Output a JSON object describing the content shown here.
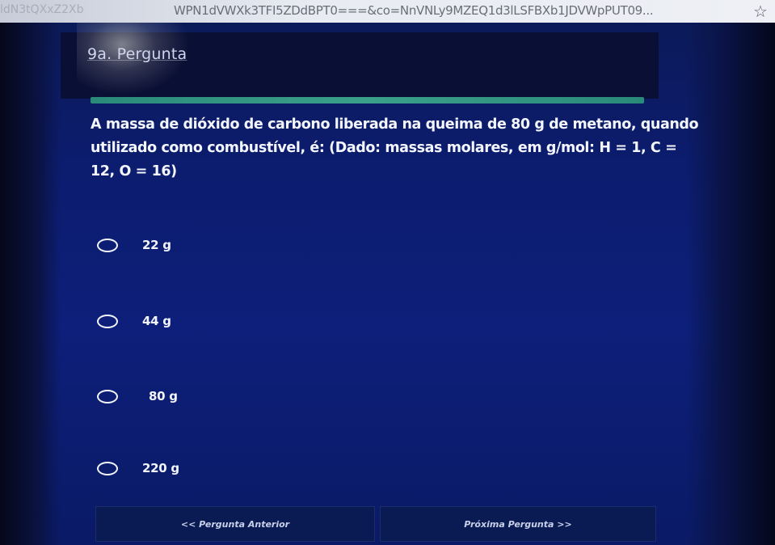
{
  "browser": {
    "url_visible": "WPN1dVWXk3TFI5ZDdBPT0===&co=NnVNLy9MZEQ1d3lLSFBXb1JDVWpPUT09...",
    "url_left_fragment": "ldN3tQXxZ2Xb"
  },
  "page": {
    "title": "9a. Pergunta"
  },
  "question": {
    "text": "A massa de dióxido de carbono liberada na queima de 80 g de metano, quando utilizado como combustível, é: (Dado: massas molares, em g/mol: H = 1, C = 12, O = 16)"
  },
  "options": [
    {
      "label": "22 g"
    },
    {
      "label": "44 g"
    },
    {
      "label": "80 g"
    },
    {
      "label": "220 g"
    }
  ],
  "nav": {
    "prev_label": "<< Pergunta Anterior",
    "next_label": "Próxima Pergunta >>"
  },
  "colors": {
    "background": "#0d1f7a",
    "header_band": "#0a0f35",
    "divider": "#3aa08a",
    "text": "#f4f6ff"
  },
  "icons": {
    "star": "star-outline-icon",
    "radio": "radio-unchecked-icon"
  }
}
